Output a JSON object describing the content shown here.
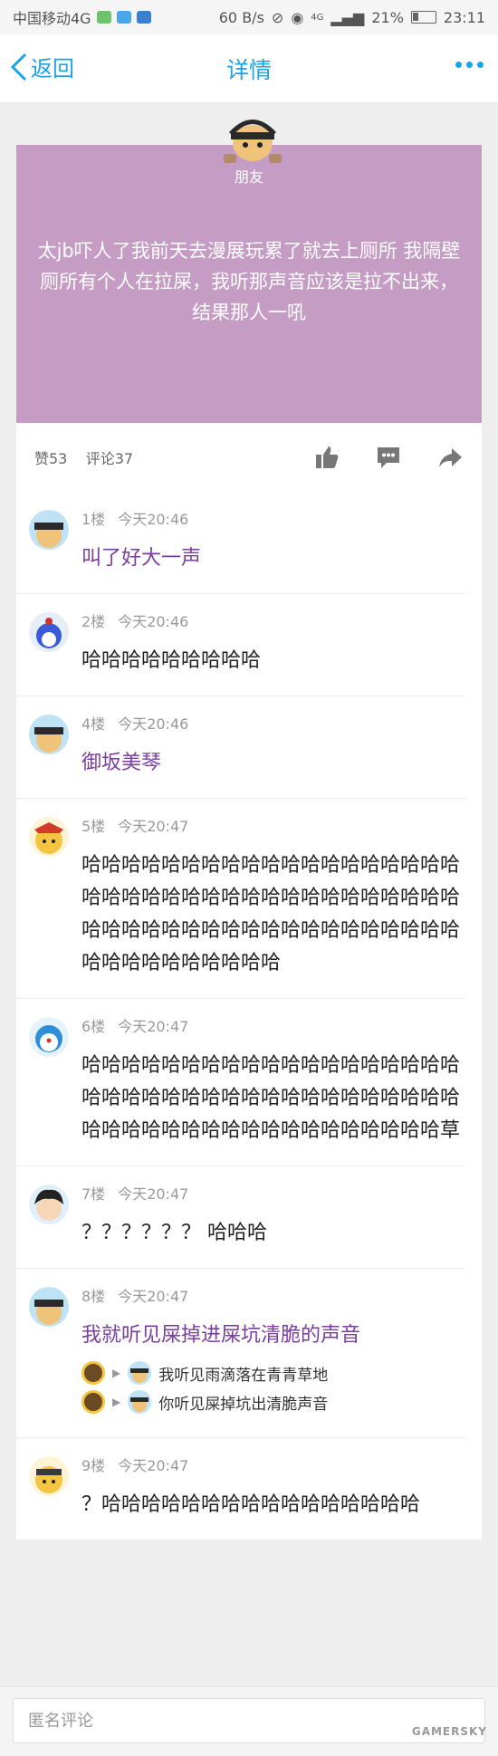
{
  "status": {
    "carrier": "中国移动4G",
    "speed": "60 B/s",
    "battery": "21%",
    "time": "23:11",
    "signal": "4G"
  },
  "nav": {
    "back_label": "返回",
    "title": "详情"
  },
  "post": {
    "author": "朋友",
    "text": "太jb吓人了我前天去漫展玩累了就去上厕所 我隔壁厕所有个人在拉屎，我听那声音应该是拉不出来，结果那人一吼",
    "likes": "赞53",
    "comments_count": "评论37"
  },
  "comments": [
    {
      "floor": "1楼",
      "time": "今天20:46",
      "text": "叫了好大一声",
      "purple": true
    },
    {
      "floor": "2楼",
      "time": "今天20:46",
      "text": "哈哈哈哈哈哈哈哈哈",
      "purple": false
    },
    {
      "floor": "4楼",
      "time": "今天20:46",
      "text": "御坂美琴",
      "purple": true
    },
    {
      "floor": "5楼",
      "time": "今天20:47",
      "text": "哈哈哈哈哈哈哈哈哈哈哈哈哈哈哈哈哈哈哈哈哈哈哈哈哈哈哈哈哈哈哈哈哈哈哈哈哈哈哈哈哈哈哈哈哈哈哈哈哈哈哈哈哈哈哈哈哈哈哈哈哈哈哈哈哈哈哈",
      "purple": false
    },
    {
      "floor": "6楼",
      "time": "今天20:47",
      "text": "哈哈哈哈哈哈哈哈哈哈哈哈哈哈哈哈哈哈哈哈哈哈哈哈哈哈哈哈哈哈哈哈哈哈哈哈哈哈哈哈哈哈哈哈哈哈哈哈哈哈哈哈哈哈哈哈草",
      "purple": false
    },
    {
      "floor": "7楼",
      "time": "今天20:47",
      "text": "？？？？？？ 哈哈哈",
      "purple": false
    },
    {
      "floor": "8楼",
      "time": "今天20:47",
      "text": "我就听见屎掉进屎坑清脆的声音",
      "purple": true,
      "replies": [
        "我听见雨滴落在青青草地",
        "你听见屎掉坑出清脆声音"
      ]
    },
    {
      "floor": "9楼",
      "time": "今天20:47",
      "text": "？哈哈哈哈哈哈哈哈哈哈哈哈哈哈哈哈",
      "purple": false
    }
  ],
  "input": {
    "placeholder": "匿名评论"
  },
  "watermark": "GAMERSKY",
  "colors": {
    "accent": "#1aa3e8",
    "post_bg": "#c59cc4",
    "purple_text": "#7a3e9d"
  }
}
